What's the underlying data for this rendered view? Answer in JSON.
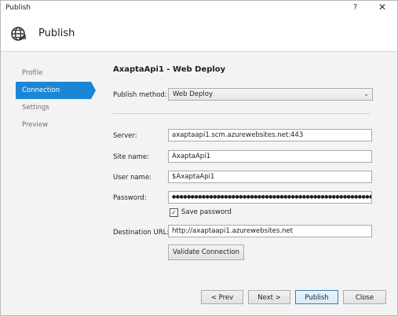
{
  "window": {
    "title": "Publish",
    "help_glyph": "?",
    "close_glyph": "✕"
  },
  "header": {
    "title": "Publish",
    "icon": "globe-publish-icon"
  },
  "nav": {
    "items": [
      {
        "label": "Profile",
        "active": false
      },
      {
        "label": "Connection",
        "active": true
      },
      {
        "label": "Settings",
        "active": false
      },
      {
        "label": "Preview",
        "active": false
      }
    ]
  },
  "profile": {
    "name": "AxaptaApi1",
    "separator": " - ",
    "kind": "Web Deploy"
  },
  "form": {
    "publish_method_label": "Publish method:",
    "publish_method_value": "Web Deploy",
    "server_label": "Server:",
    "server_value": "axaptaapi1.scm.azurewebsites.net:443",
    "site_name_label": "Site name:",
    "site_name_value": "AxaptaApi1",
    "user_name_label": "User name:",
    "user_name_value": "$AxaptaApi1",
    "password_label": "Password:",
    "password_value": "●●●●●●●●●●●●●●●●●●●●●●●●●●●●●●●●●●●●●●●●●●●●●●●●●●●●●●●●●●●●",
    "save_password_label": "Save password",
    "save_password_checked": true,
    "destination_url_label": "Destination URL:",
    "destination_url_value": "http://axaptaapi1.azurewebsites.net",
    "validate_label": "Validate Connection"
  },
  "footer": {
    "prev_label": "< Prev",
    "next_label": "Next >",
    "publish_label": "Publish",
    "close_label": "Close"
  },
  "colors": {
    "accent": "#1c86d6",
    "nav_inactive": "#707070",
    "panel_bg": "#f3f3f3"
  }
}
